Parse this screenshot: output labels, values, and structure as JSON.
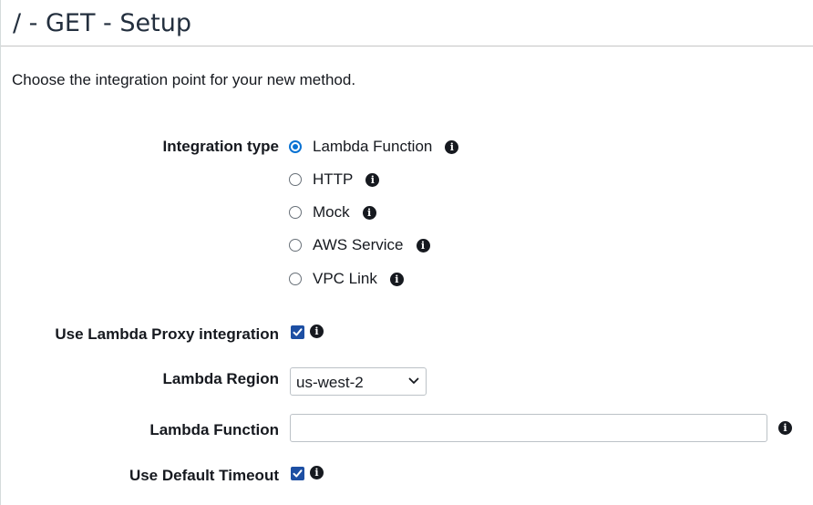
{
  "page": {
    "title": "/ - GET - Setup",
    "intro": "Choose the integration point for your new method."
  },
  "integration_type": {
    "label": "Integration type",
    "selected": "Lambda Function",
    "options": [
      {
        "label": "Lambda Function",
        "checked": true
      },
      {
        "label": "HTTP",
        "checked": false
      },
      {
        "label": "Mock",
        "checked": false
      },
      {
        "label": "AWS Service",
        "checked": false
      },
      {
        "label": "VPC Link",
        "checked": false
      }
    ]
  },
  "lambda_proxy": {
    "label": "Use Lambda Proxy integration",
    "checked": true
  },
  "lambda_region": {
    "label": "Lambda Region",
    "value": "us-west-2"
  },
  "lambda_function": {
    "label": "Lambda Function",
    "value": "",
    "placeholder": ""
  },
  "default_timeout": {
    "label": "Use Default Timeout",
    "checked": true
  },
  "icons": {
    "info": "info-icon",
    "chevron": "chevron-down-icon",
    "check": "check-icon"
  },
  "colors": {
    "radio_selected": "#0972d3",
    "checkbox_fill": "#1d4fa3",
    "text": "#16191f"
  }
}
